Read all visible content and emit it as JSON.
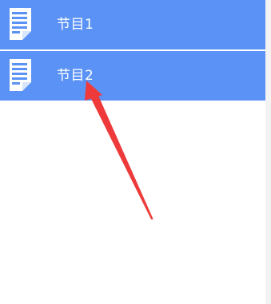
{
  "list": {
    "items": [
      {
        "label": "节目1",
        "icon": "document-icon"
      },
      {
        "label": "节目2",
        "icon": "document-icon"
      }
    ]
  },
  "colors": {
    "row_background": "#5b92f5",
    "row_text": "#ffffff",
    "annotation_arrow": "#ee3a3a"
  }
}
